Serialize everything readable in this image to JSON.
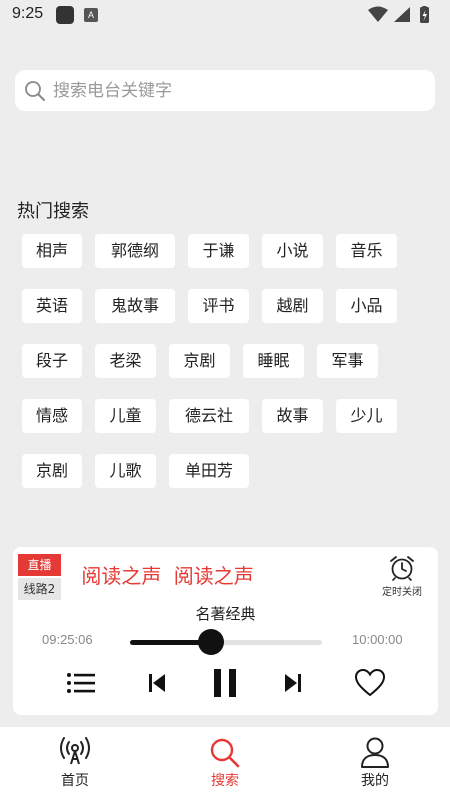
{
  "status_bar": {
    "time": "9:25",
    "a_badge": "A"
  },
  "search": {
    "placeholder": "搜索电台关键字",
    "value": ""
  },
  "hot_search": {
    "title": "热门搜索",
    "tags": [
      "相声",
      "郭德纲",
      "于谦",
      "小说",
      "音乐",
      "英语",
      "鬼故事",
      "评书",
      "越剧",
      "小品",
      "段子",
      "老梁",
      "京剧",
      "睡眠",
      "军事",
      "情感",
      "儿童",
      "德云社",
      "故事",
      "少儿",
      "京剧",
      "儿歌",
      "单田芳"
    ]
  },
  "player": {
    "live_label": "直播",
    "line_label": "线路2",
    "marquee_text": "声 阅读之声 阅读之声",
    "timer_label": "定时关闭",
    "program_name": "名著经典",
    "current_time": "09:25:06",
    "end_time": "10:00:00",
    "progress": 0.42,
    "accent_color": "#e53935"
  },
  "tabs": [
    {
      "label": "首页",
      "icon": "radio-broadcast-icon",
      "active": false
    },
    {
      "label": "搜索",
      "icon": "search-icon",
      "active": true
    },
    {
      "label": "我的",
      "icon": "user-icon",
      "active": false
    }
  ]
}
